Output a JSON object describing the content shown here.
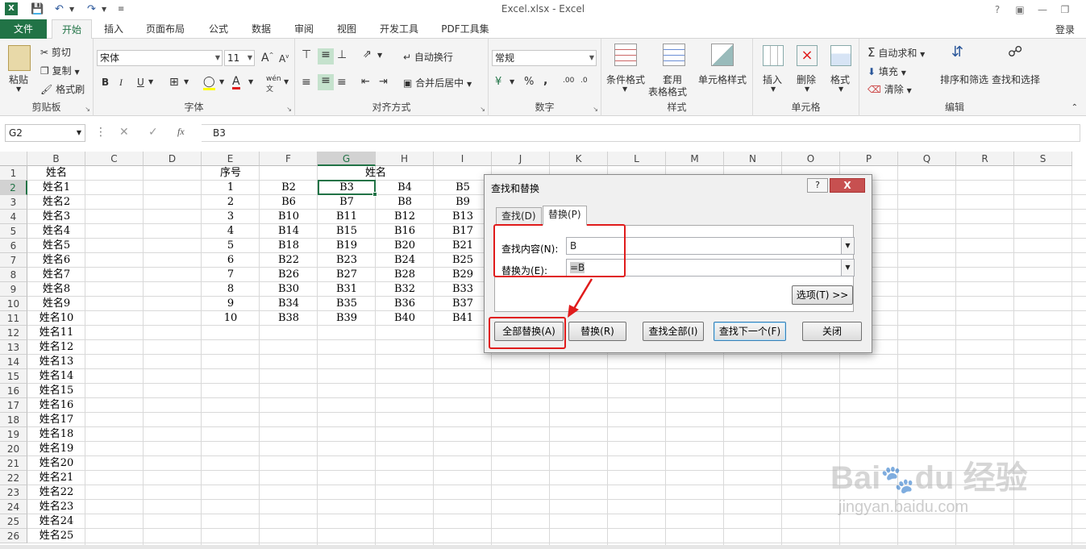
{
  "window": {
    "title": "Excel.xlsx - Excel",
    "login": "登录"
  },
  "tabs": [
    "文件",
    "开始",
    "插入",
    "页面布局",
    "公式",
    "数据",
    "审阅",
    "视图",
    "开发工具",
    "PDF工具集"
  ],
  "ribbon": {
    "clipboard": {
      "paste": "粘贴",
      "cut": "剪切",
      "copy": "复制",
      "format_painter": "格式刷",
      "label": "剪贴板"
    },
    "font": {
      "name": "宋体",
      "size": "11",
      "label": "字体",
      "bold": "B",
      "italic": "I",
      "underline": "U",
      "grow": "A",
      "shrink": "A"
    },
    "alignment": {
      "wrap": "自动换行",
      "merge": "合并后居中",
      "label": "对齐方式"
    },
    "number": {
      "format": "常规",
      "percent": "%",
      "comma": ",",
      "label": "数字"
    },
    "styles": {
      "conditional": "条件格式",
      "table": "套用",
      "table2": "表格格式",
      "cell_styles": "单元格样式",
      "label": "样式"
    },
    "cells": {
      "insert": "插入",
      "delete": "删除",
      "format": "格式",
      "label": "单元格"
    },
    "editing": {
      "autosum": "自动求和",
      "fill": "填充",
      "clear": "清除",
      "sort": "排序和筛选",
      "find": "查找和选择",
      "label": "编辑"
    }
  },
  "formula_bar": {
    "name_box": "G2",
    "formula": "B3",
    "fx": "fx"
  },
  "columns": [
    "B",
    "C",
    "D",
    "E",
    "F",
    "G",
    "H",
    "I",
    "J",
    "K",
    "L",
    "M",
    "N",
    "O",
    "P",
    "Q",
    "R",
    "S"
  ],
  "rows": [
    "1",
    "2",
    "3",
    "4",
    "5",
    "6",
    "7",
    "8",
    "9",
    "10",
    "11",
    "12",
    "13",
    "14",
    "15",
    "16",
    "17",
    "18",
    "19",
    "20",
    "21",
    "22",
    "23",
    "24",
    "25",
    "26"
  ],
  "col_b": [
    "姓名",
    "姓名1",
    "姓名2",
    "姓名3",
    "姓名4",
    "姓名5",
    "姓名6",
    "姓名7",
    "姓名8",
    "姓名9",
    "姓名10",
    "姓名11",
    "姓名12",
    "姓名13",
    "姓名14",
    "姓名15",
    "姓名16",
    "姓名17",
    "姓名18",
    "姓名19",
    "姓名20",
    "姓名21",
    "姓名22",
    "姓名23",
    "姓名24",
    "姓名25"
  ],
  "header_row": {
    "seq": "序号",
    "name": "姓名"
  },
  "table": [
    [
      "1",
      "B2",
      "B3",
      "B4",
      "B5"
    ],
    [
      "2",
      "B6",
      "B7",
      "B8",
      "B9"
    ],
    [
      "3",
      "B10",
      "B11",
      "B12",
      "B13"
    ],
    [
      "4",
      "B14",
      "B15",
      "B16",
      "B17"
    ],
    [
      "5",
      "B18",
      "B19",
      "B20",
      "B21"
    ],
    [
      "6",
      "B22",
      "B23",
      "B24",
      "B25"
    ],
    [
      "7",
      "B26",
      "B27",
      "B28",
      "B29"
    ],
    [
      "8",
      "B30",
      "B31",
      "B32",
      "B33"
    ],
    [
      "9",
      "B34",
      "B35",
      "B36",
      "B37"
    ],
    [
      "10",
      "B38",
      "B39",
      "B40",
      "B41"
    ]
  ],
  "dialog": {
    "title": "查找和替换",
    "help": "?",
    "close": "X",
    "tab_find": "查找(D)",
    "tab_replace": "替换(P)",
    "find_label": "查找内容(N):",
    "find_value": "B",
    "replace_label": "替换为(E):",
    "replace_value": "=B",
    "options": "选项(T) >>",
    "replace_all": "全部替换(A)",
    "replace": "替换(R)",
    "find_all": "查找全部(I)",
    "find_next": "查找下一个(F)",
    "close_btn": "关闭"
  },
  "accent": "#217346",
  "highlight": "#e01b1b"
}
